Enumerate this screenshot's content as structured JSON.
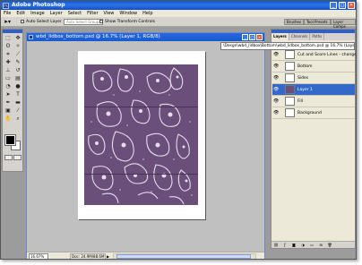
{
  "app": {
    "title": "Adobe Photoshop",
    "icon_name": "photoshop-icon"
  },
  "window_buttons": {
    "minimize": "_",
    "maximize": "□",
    "close": "✕"
  },
  "menu": [
    "File",
    "Edit",
    "Image",
    "Layer",
    "Select",
    "Filter",
    "View",
    "Window",
    "Help"
  ],
  "options_bar": {
    "tool_icon": "move-tool-icon",
    "auto_select_label": "Auto Select Layer",
    "dropdown_label": "Auto Select Groups",
    "show_transform_label": "Show Transform Controls",
    "palette_tabs": [
      "Brushes",
      "Tool Presets",
      "Layer Comps"
    ]
  },
  "tools": [
    {
      "icon": "marquee-icon",
      "glyph": "⬚"
    },
    {
      "icon": "move-icon",
      "glyph": "✥"
    },
    {
      "icon": "lasso-icon",
      "glyph": "ʘ"
    },
    {
      "icon": "magic-wand-icon",
      "glyph": "✧"
    },
    {
      "icon": "crop-icon",
      "glyph": "⌗"
    },
    {
      "icon": "slice-icon",
      "glyph": "⟋"
    },
    {
      "icon": "healing-icon",
      "glyph": "✚"
    },
    {
      "icon": "brush-icon",
      "glyph": "✎"
    },
    {
      "icon": "stamp-icon",
      "glyph": "⊥"
    },
    {
      "icon": "history-brush-icon",
      "glyph": "↺"
    },
    {
      "icon": "eraser-icon",
      "glyph": "▭"
    },
    {
      "icon": "gradient-icon",
      "glyph": "▤"
    },
    {
      "icon": "blur-icon",
      "glyph": "◔"
    },
    {
      "icon": "dodge-icon",
      "glyph": "●"
    },
    {
      "icon": "path-select-icon",
      "glyph": "➤"
    },
    {
      "icon": "type-icon",
      "glyph": "T"
    },
    {
      "icon": "pen-icon",
      "glyph": "✒"
    },
    {
      "icon": "shape-icon",
      "glyph": "▬"
    },
    {
      "icon": "notes-icon",
      "glyph": "▣"
    },
    {
      "icon": "eyedropper-icon",
      "glyph": "⁄"
    },
    {
      "icon": "hand-icon",
      "glyph": "✋"
    },
    {
      "icon": "zoom-icon",
      "glyph": "⌕"
    }
  ],
  "colors": {
    "foreground": "#000000",
    "background": "#ffffff",
    "pattern_base": "#6a4f7a",
    "selection": "#3468c9"
  },
  "document": {
    "title": "wbd_lidbox_bottom.psd @ 16.7% (Layer 1, RGB/8)",
    "zoom": "16.67%",
    "doc_info": "Doc: 24.9M/88.6M",
    "status_arrow": "▶"
  },
  "layers_panel": {
    "tabs": [
      "Layers",
      "Channels",
      "Paths"
    ],
    "file_path": "\\Desgn\\wbd_lidbox\\Bottom\\wbd_lidbox_bottom.psd @ 16.7% (Layer 1, RGB/8)",
    "layers": [
      {
        "name": "Cut and Score Lines - change to soft L...",
        "visible": true,
        "thumb": "white",
        "selected": false
      },
      {
        "name": "Bottom",
        "visible": true,
        "thumb": "white",
        "selected": false
      },
      {
        "name": "Sides",
        "visible": true,
        "thumb": "white",
        "selected": false
      },
      {
        "name": "Layer 1",
        "visible": true,
        "thumb": "purple",
        "selected": true
      },
      {
        "name": "Fill",
        "visible": true,
        "thumb": "white",
        "selected": false
      },
      {
        "name": "Background",
        "visible": true,
        "thumb": "white",
        "selected": false
      }
    ],
    "footer_icons": [
      "link-icon",
      "style-icon",
      "mask-icon",
      "adjust-icon",
      "folder-icon",
      "new-layer-icon",
      "trash-icon"
    ]
  }
}
